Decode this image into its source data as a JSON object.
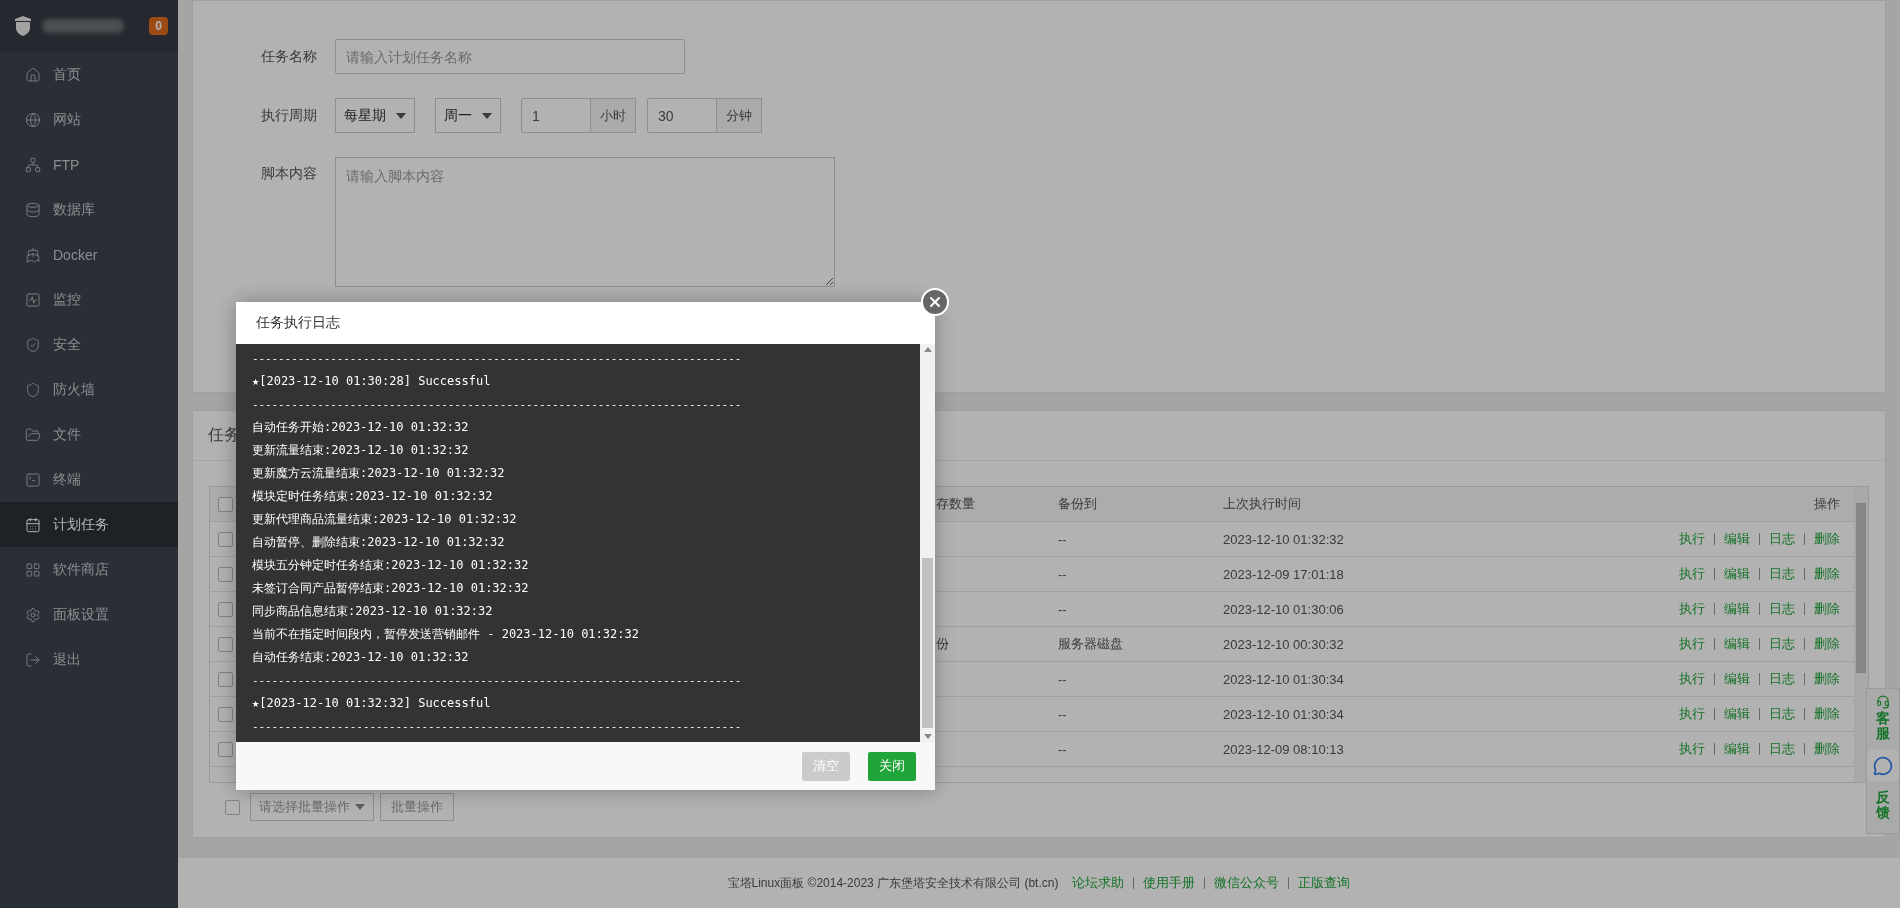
{
  "sidebar": {
    "badge": "0",
    "items": [
      {
        "label": "首页",
        "selected": false
      },
      {
        "label": "网站",
        "selected": false
      },
      {
        "label": "FTP",
        "selected": false
      },
      {
        "label": "数据库",
        "selected": false
      },
      {
        "label": "Docker",
        "selected": false
      },
      {
        "label": "监控",
        "selected": false
      },
      {
        "label": "安全",
        "selected": false
      },
      {
        "label": "防火墙",
        "selected": false
      },
      {
        "label": "文件",
        "selected": false
      },
      {
        "label": "终端",
        "selected": false
      },
      {
        "label": "计划任务",
        "selected": true
      },
      {
        "label": "软件商店",
        "selected": false
      },
      {
        "label": "面板设置",
        "selected": false
      },
      {
        "label": "退出",
        "selected": false
      }
    ]
  },
  "task_form": {
    "task_name": {
      "label": "任务名称",
      "placeholder": "请输入计划任务名称"
    },
    "cycle": {
      "label": "执行周期",
      "period": "每星期",
      "weekday": "周一",
      "hour": "1",
      "hour_unit": "小时",
      "minute": "30",
      "minute_unit": "分钟"
    },
    "script": {
      "label": "脚本内容",
      "placeholder": "请输入脚本内容"
    }
  },
  "task_list": {
    "title": "任务",
    "header_checked": false,
    "columns": [
      "存数量",
      "备份到",
      "上次执行时间",
      "操作"
    ],
    "rows": [
      {
        "checked": false,
        "backup_to": "--",
        "last_run": "2023-12-10 01:32:32",
        "actions": [
          "执行",
          "编辑",
          "日志",
          "删除"
        ]
      },
      {
        "checked": false,
        "backup_to": "--",
        "last_run": "2023-12-09 17:01:18",
        "actions": [
          "执行",
          "编辑",
          "日志",
          "删除"
        ]
      },
      {
        "checked": false,
        "backup_to": "--",
        "last_run": "2023-12-10 01:30:06",
        "actions": [
          "执行",
          "编辑",
          "日志",
          "删除"
        ]
      },
      {
        "checked": false,
        "retention": "份",
        "backup_to": "服务器磁盘",
        "last_run": "2023-12-10 00:30:32",
        "actions": [
          "执行",
          "编辑",
          "日志",
          "删除"
        ]
      },
      {
        "checked": false,
        "backup_to": "--",
        "last_run": "2023-12-10 01:30:34",
        "actions": [
          "执行",
          "编辑",
          "日志",
          "删除"
        ]
      },
      {
        "checked": false,
        "backup_to": "--",
        "last_run": "2023-12-10 01:30:34",
        "actions": [
          "执行",
          "编辑",
          "日志",
          "删除"
        ]
      },
      {
        "checked": false,
        "backup_to": "--",
        "last_run": "2023-12-09 08:10:13",
        "actions": [
          "执行",
          "编辑",
          "日志",
          "删除"
        ]
      }
    ],
    "batch": {
      "checked": false,
      "placeholder": "请选择批量操作",
      "button": "批量操作"
    }
  },
  "footer": {
    "text": "宝塔Linux面板 ©2014-2023 广东堡塔安全技术有限公司 (bt.cn)",
    "links": [
      "论坛求助",
      "使用手册",
      "微信公众号",
      "正版查询"
    ]
  },
  "float_bar": {
    "service": "客服",
    "feedback": "反馈"
  },
  "modal": {
    "title": "任务执行日志",
    "lines": [
      {
        "kind": "rule",
        "text": "---------------------------------------------------------------------------"
      },
      {
        "kind": "result",
        "text": "★[2023-12-10 01:30:28] Successful"
      },
      {
        "kind": "rule",
        "text": "---------------------------------------------------------------------------"
      },
      {
        "kind": "text",
        "text": "自动任务开始:2023-12-10 01:32:32"
      },
      {
        "kind": "text",
        "text": "更新流量结束:2023-12-10 01:32:32"
      },
      {
        "kind": "text",
        "text": "更新魔方云流量结束:2023-12-10 01:32:32"
      },
      {
        "kind": "text",
        "text": "模块定时任务结束:2023-12-10 01:32:32"
      },
      {
        "kind": "text",
        "text": "更新代理商品流量结束:2023-12-10 01:32:32"
      },
      {
        "kind": "text",
        "text": "自动暂停、删除结束:2023-12-10 01:32:32"
      },
      {
        "kind": "text",
        "text": "模块五分钟定时任务结束:2023-12-10 01:32:32"
      },
      {
        "kind": "text",
        "text": "未签订合同产品暂停结束:2023-12-10 01:32:32"
      },
      {
        "kind": "text",
        "text": "同步商品信息结束:2023-12-10 01:32:32"
      },
      {
        "kind": "text",
        "text": "当前不在指定时间段内，暂停发送营销邮件 - 2023-12-10 01:32:32"
      },
      {
        "kind": "text",
        "text": "自动任务结束:2023-12-10 01:32:32"
      },
      {
        "kind": "rule",
        "text": "---------------------------------------------------------------------------"
      },
      {
        "kind": "result",
        "text": "★[2023-12-10 01:32:32] Successful"
      },
      {
        "kind": "rule",
        "text": "---------------------------------------------------------------------------"
      }
    ],
    "buttons": [
      {
        "kind": "secondary",
        "label": "清空"
      },
      {
        "kind": "primary",
        "label": "关闭"
      }
    ]
  }
}
